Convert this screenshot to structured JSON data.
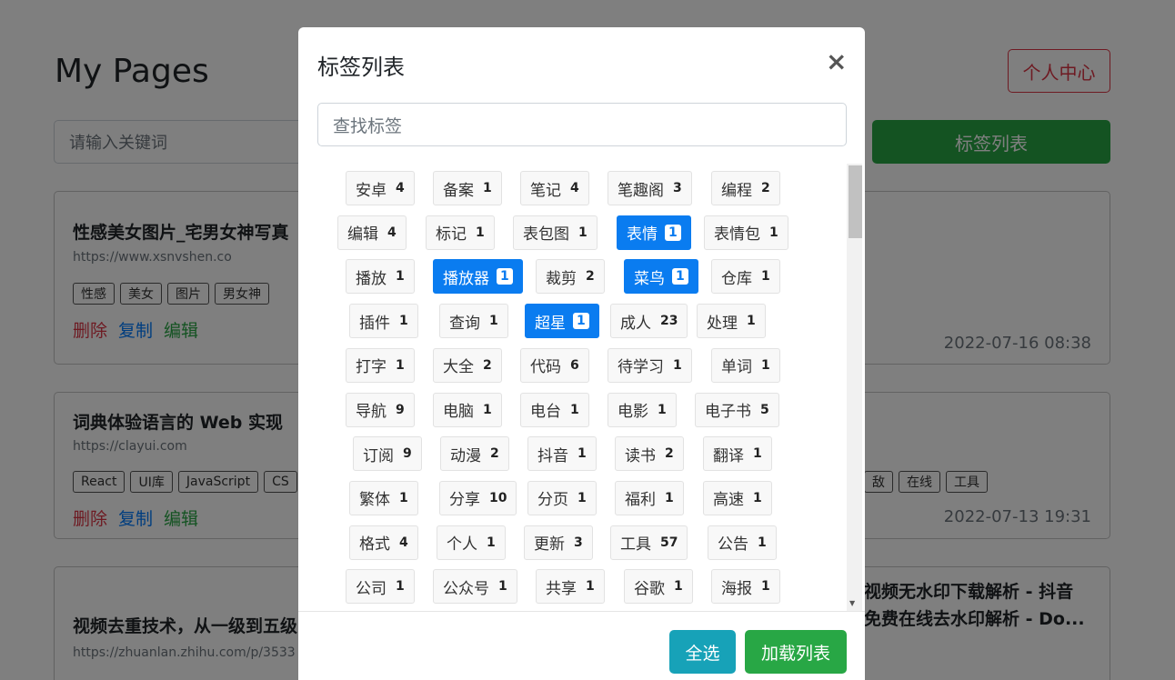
{
  "page": {
    "title": "My Pages",
    "user_center": "个人中心",
    "search_placeholder": "请输入关键词",
    "tag_list_button": "标签列表"
  },
  "cards": [
    {
      "title": "性感美女图片_宅男女神写真",
      "url": "https://www.xsnvshen.co",
      "tags": [
        "性感",
        "美女",
        "图片",
        "男女神"
      ],
      "actions": {
        "delete": "删除",
        "copy": "复制",
        "edit": "编辑"
      },
      "date": "2022-07-16 08:38"
    },
    {
      "title": "词典体验语言的 Web 实现",
      "url": "https://clayui.com",
      "tags": [
        "React",
        "UI库",
        "JavaScript",
        "CS"
      ],
      "right_tags": [
        "敌",
        "在线",
        "工具"
      ],
      "actions": {
        "delete": "删除",
        "copy": "复制",
        "edit": "编辑"
      },
      "date": "2022-07-13 19:31"
    },
    {
      "title": "视频去重技术，从一级到五级",
      "url": "https://zhuanlan.zhihu.com/p/3533",
      "right_title_1": "视频无水印下载解析 - 抖音",
      "right_title_2": "免费在线去水印解析 - Do..."
    }
  ],
  "modal": {
    "title": "标签列表",
    "close": "×",
    "search_placeholder": "查找标签",
    "select_all": "全选",
    "load_list": "加载列表"
  },
  "tag_rows": [
    [
      {
        "name": "安卓",
        "count": "4"
      },
      {
        "name": "备案",
        "count": "1"
      },
      {
        "name": "笔记",
        "count": "4"
      },
      {
        "name": "笔趣阁",
        "count": "3"
      },
      {
        "name": "编程",
        "count": "2"
      }
    ],
    [
      {
        "name": "编辑",
        "count": "4"
      },
      {
        "name": "标记",
        "count": "1"
      },
      {
        "name": "表包图",
        "count": "1"
      },
      {
        "name": "表情",
        "count": "1",
        "active": true
      },
      {
        "name": "表情包",
        "count": "1"
      }
    ],
    [
      {
        "name": "播放",
        "count": "1"
      },
      {
        "name": "播放器",
        "count": "1",
        "active": true
      },
      {
        "name": "裁剪",
        "count": "2"
      },
      {
        "name": "菜鸟",
        "count": "1",
        "active": true
      },
      {
        "name": "仓库",
        "count": "1"
      }
    ],
    [
      {
        "name": "插件",
        "count": "1"
      },
      {
        "name": "查询",
        "count": "1"
      },
      {
        "name": "超星",
        "count": "1",
        "active": true
      },
      {
        "name": "成人",
        "count": "23"
      },
      {
        "name": "处理",
        "count": "1"
      }
    ],
    [
      {
        "name": "打字",
        "count": "1"
      },
      {
        "name": "大全",
        "count": "2"
      },
      {
        "name": "代码",
        "count": "6"
      },
      {
        "name": "待学习",
        "count": "1"
      },
      {
        "name": "单词",
        "count": "1"
      }
    ],
    [
      {
        "name": "导航",
        "count": "9"
      },
      {
        "name": "电脑",
        "count": "1"
      },
      {
        "name": "电台",
        "count": "1"
      },
      {
        "name": "电影",
        "count": "1"
      },
      {
        "name": "电子书",
        "count": "5"
      }
    ],
    [
      {
        "name": "订阅",
        "count": "9"
      },
      {
        "name": "动漫",
        "count": "2"
      },
      {
        "name": "抖音",
        "count": "1"
      },
      {
        "name": "读书",
        "count": "2"
      },
      {
        "name": "翻译",
        "count": "1"
      }
    ],
    [
      {
        "name": "繁体",
        "count": "1"
      },
      {
        "name": "分享",
        "count": "10"
      },
      {
        "name": "分页",
        "count": "1"
      },
      {
        "name": "福利",
        "count": "1"
      },
      {
        "name": "高速",
        "count": "1"
      }
    ],
    [
      {
        "name": "格式",
        "count": "4"
      },
      {
        "name": "个人",
        "count": "1"
      },
      {
        "name": "更新",
        "count": "3"
      },
      {
        "name": "工具",
        "count": "57"
      },
      {
        "name": "公告",
        "count": "1"
      }
    ],
    [
      {
        "name": "公司",
        "count": "1"
      },
      {
        "name": "公众号",
        "count": "1"
      },
      {
        "name": "共享",
        "count": "1"
      },
      {
        "name": "谷歌",
        "count": "1"
      },
      {
        "name": "海报",
        "count": "1"
      }
    ]
  ]
}
